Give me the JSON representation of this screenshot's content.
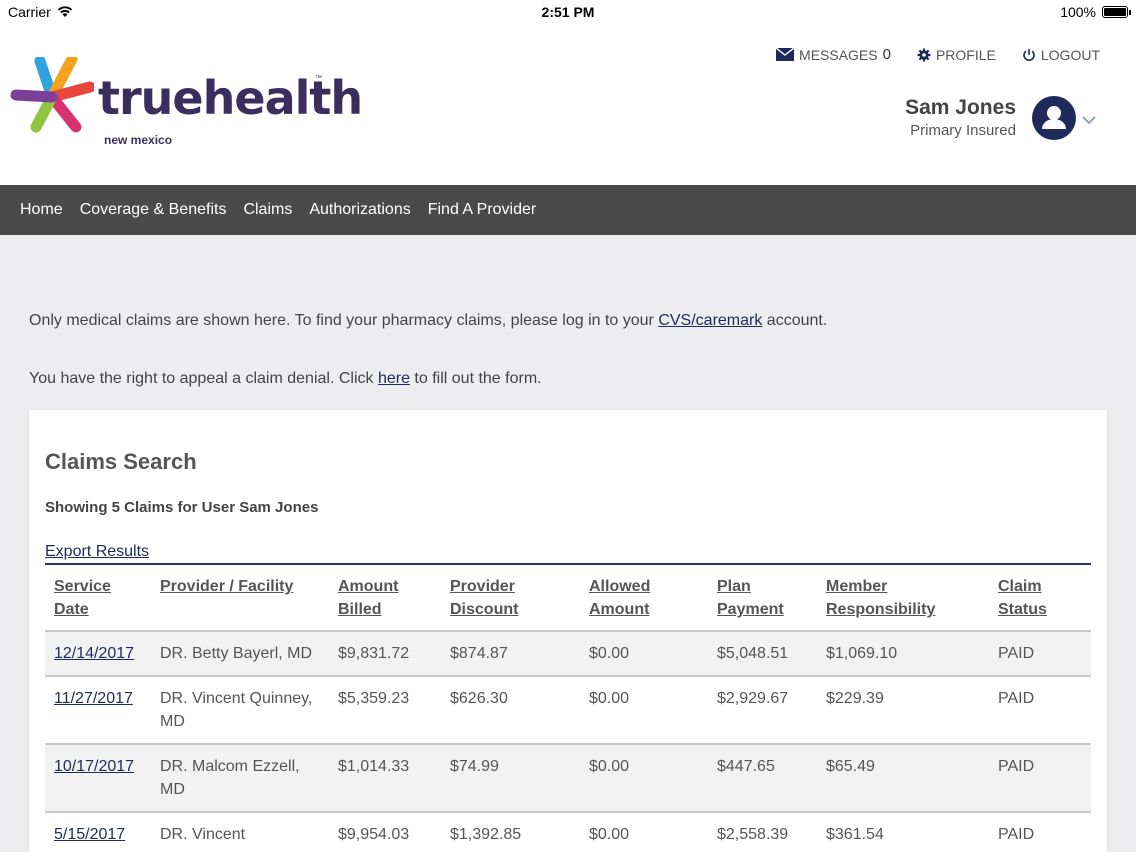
{
  "status_bar": {
    "carrier": "Carrier",
    "time": "2:51 PM",
    "battery": "100%"
  },
  "brand": {
    "name": "truehealth",
    "tm": "™",
    "region": "new mexico"
  },
  "top_nav": {
    "messages_label": "MESSAGES",
    "messages_count": "0",
    "profile_label": "PROFILE",
    "logout_label": "LOGOUT"
  },
  "user": {
    "name": "Sam Jones",
    "role": "Primary Insured"
  },
  "main_nav": [
    "Home",
    "Coverage & Benefits",
    "Claims",
    "Authorizations",
    "Find A Provider"
  ],
  "notices": {
    "pharmacy_before": "Only medical claims are shown here. To find your pharmacy claims, please log in to your ",
    "pharmacy_link": "CVS/caremark",
    "pharmacy_after": " account.",
    "appeal_before": "You have the right to appeal a claim denial. Click ",
    "appeal_link": "here",
    "appeal_after": " to fill out the form."
  },
  "claims": {
    "title": "Claims Search",
    "subtitle": "Showing 5 Claims for User Sam Jones",
    "export_label": "Export Results",
    "columns": [
      "Service Date",
      "Provider / Facility",
      "Amount Billed",
      "Provider Discount",
      "Allowed Amount",
      "Plan Payment",
      "Member Responsibility",
      "Claim Status"
    ],
    "rows": [
      {
        "date": "12/14/2017",
        "provider": "DR. Betty Bayerl, MD",
        "billed": "$9,831.72",
        "discount": "$874.87",
        "allowed": "$0.00",
        "plan": "$5,048.51",
        "member": "$1,069.10",
        "status": "PAID"
      },
      {
        "date": "11/27/2017",
        "provider": "DR. Vincent Quinney, MD",
        "billed": "$5,359.23",
        "discount": "$626.30",
        "allowed": "$0.00",
        "plan": "$2,929.67",
        "member": "$229.39",
        "status": "PAID"
      },
      {
        "date": "10/17/2017",
        "provider": "DR. Malcom Ezzell, MD",
        "billed": "$1,014.33",
        "discount": "$74.99",
        "allowed": "$0.00",
        "plan": "$447.65",
        "member": "$65.49",
        "status": "PAID"
      },
      {
        "date": "5/15/2017",
        "provider": "DR. Vincent",
        "billed": "$9,954.03",
        "discount": "$1,392.85",
        "allowed": "$0.00",
        "plan": "$2,558.39",
        "member": "$361.54",
        "status": "PAID"
      }
    ]
  }
}
